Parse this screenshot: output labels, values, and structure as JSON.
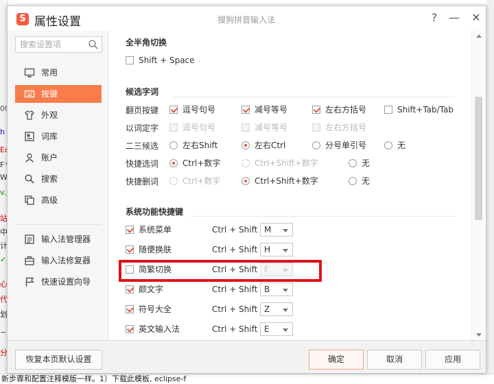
{
  "background": {
    "left_fragments": [
      "00",
      "h",
      "Ec",
      "F⁺",
      "Wi",
      "v.j",
      "站",
      "中",
      "计",
      "✓",
      "心",
      "代",
      "划",
      "~",
      "分"
    ],
    "bottom_text": "新步骤和配置注释模版一样。1）下载此模板, eclipse-f"
  },
  "window": {
    "title": "属性设置",
    "app_name": "搜狗拼音输入法",
    "help_label": "?",
    "minimize_label": "—",
    "close_label": "✕"
  },
  "sidebar": {
    "search_placeholder": "搜索设置项",
    "items": [
      {
        "label": "常用",
        "icon": "monitor-icon",
        "active": false
      },
      {
        "label": "按键",
        "icon": "keyboard-icon",
        "active": true
      },
      {
        "label": "外观",
        "icon": "shirt-icon",
        "active": false
      },
      {
        "label": "词库",
        "icon": "book-icon",
        "active": false
      },
      {
        "label": "账户",
        "icon": "user-icon",
        "active": false
      },
      {
        "label": "搜索",
        "icon": "search-icon",
        "active": false
      },
      {
        "label": "高级",
        "icon": "layers-icon",
        "active": false
      }
    ],
    "tools": [
      {
        "label": "输入法管理器",
        "icon": "list-icon"
      },
      {
        "label": "输入法修复器",
        "icon": "toolbox-icon"
      },
      {
        "label": "快速设置向导",
        "icon": "flag-icon"
      }
    ]
  },
  "sections": {
    "full_half": {
      "title": "全半角切换",
      "option": {
        "label": "Shift + Space",
        "checked": false
      }
    },
    "candidates": {
      "title": "候选字词",
      "page_turn": {
        "label": "翻页按键",
        "options": [
          {
            "label": "逗号句号",
            "checked": true
          },
          {
            "label": "减号等号",
            "checked": true
          },
          {
            "label": "左右方括号",
            "checked": true
          },
          {
            "label": "Shift+Tab/Tab",
            "checked": false
          }
        ]
      },
      "word_to_char": {
        "label": "以词定字",
        "options": [
          {
            "label": "逗号句号",
            "checked": false
          },
          {
            "label": "减号等号",
            "checked": false
          },
          {
            "label": "左右方括号",
            "checked": false
          }
        ]
      },
      "second_third": {
        "label": "二三候选",
        "options": [
          {
            "label": "左右Shift",
            "selected": false
          },
          {
            "label": "左右Ctrl",
            "selected": true
          },
          {
            "label": "分号单引号",
            "selected": false
          },
          {
            "label": "无",
            "selected": false
          }
        ]
      },
      "quick_select": {
        "label": "快捷选词",
        "options": [
          {
            "label": "Ctrl+数字",
            "selected": true,
            "disabled": false
          },
          {
            "label": "Ctrl+Shift+数字",
            "selected": false,
            "disabled": true
          },
          {
            "label": "无",
            "selected": false,
            "disabled": false
          }
        ]
      },
      "quick_delete": {
        "label": "快捷删词",
        "options": [
          {
            "label": "Ctrl+数字",
            "selected": false,
            "disabled": true
          },
          {
            "label": "Ctrl+Shift+数字",
            "selected": true,
            "disabled": false
          },
          {
            "label": "无",
            "selected": false,
            "disabled": false
          }
        ]
      }
    },
    "hotkeys": {
      "title": "系统功能快捷键",
      "prefix": "Ctrl + Shift +",
      "items": [
        {
          "label": "系统菜单",
          "checked": true,
          "key": "M"
        },
        {
          "label": "随便换肤",
          "checked": true,
          "key": "H"
        },
        {
          "label": "简繁切换",
          "checked": false,
          "key": "F"
        },
        {
          "label": "颜文字",
          "checked": true,
          "key": "B"
        },
        {
          "label": "符号大全",
          "checked": true,
          "key": "Z"
        },
        {
          "label": "英文输入法",
          "checked": true,
          "key": "E"
        }
      ]
    }
  },
  "footer": {
    "restore_label": "恢复本页默认设置",
    "ok_label": "确定",
    "cancel_label": "取消",
    "apply_label": "应用"
  },
  "colors": {
    "accent": "#f97d4a",
    "check": "#e2553b",
    "highlight_box": "#e3101a",
    "logo": "#f5593e"
  }
}
